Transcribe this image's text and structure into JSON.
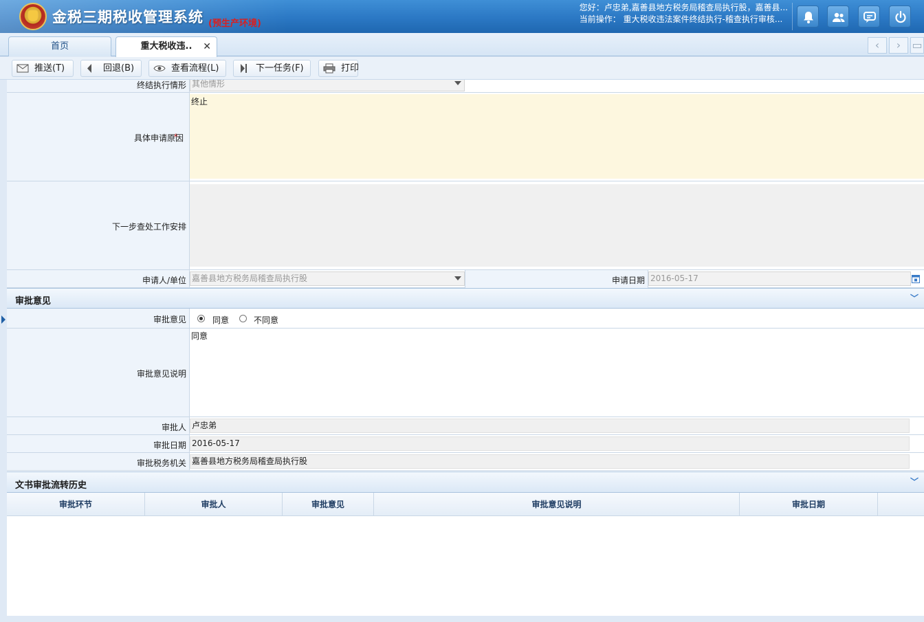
{
  "header": {
    "app_title": "金税三期税收管理系统",
    "env_tag": "(预生产环境)",
    "greeting": "您好：卢忠弟,嘉善县地方税务局稽查局执行股，嘉善县...",
    "current_op": "当前操作：  重大税收违法案件终结执行-稽查执行审核..."
  },
  "tabs": [
    {
      "label": "首页"
    },
    {
      "label": "重大税收违..",
      "close": "✕"
    }
  ],
  "toolbar": {
    "push": "推送(T)",
    "back": "回退(B)",
    "view_flow": "查看流程(L)",
    "next_task": "下一任务(F)",
    "print": "打印"
  },
  "form": {
    "end_exec_label": "终结执行情形",
    "end_exec_value": "其他情形",
    "reason_label": "具体申请原因",
    "reason_required": "*",
    "reason_value": "终止",
    "next_step_label": "下一步查处工作安排",
    "next_step_value": "",
    "applicant_label": "申请人/单位",
    "applicant_value": "嘉善县地方税务局稽查局执行股",
    "apply_date_label": "申请日期",
    "apply_date_value": "2016-05-17"
  },
  "approval": {
    "section_title": "审批意见",
    "opinion_label": "审批意见",
    "agree": "同意",
    "disagree": "不同意",
    "selected": "agree",
    "desc_label": "审批意见说明",
    "desc_value": "同意",
    "approver_label": "审批人",
    "approver_value": "卢忠弟",
    "date_label": "审批日期",
    "date_value": "2016-05-17",
    "office_label": "审批税务机关",
    "office_value": "嘉善县地方税务局稽查局执行股"
  },
  "history": {
    "section_title": "文书审批流转历史",
    "columns": [
      "审批环节",
      "审批人",
      "审批意见",
      "审批意见说明",
      "审批日期"
    ],
    "rows": []
  },
  "colors": {
    "header_blue": "#2b78c4",
    "required_red": "#dd0000",
    "reason_bg": "#fdf7df"
  }
}
